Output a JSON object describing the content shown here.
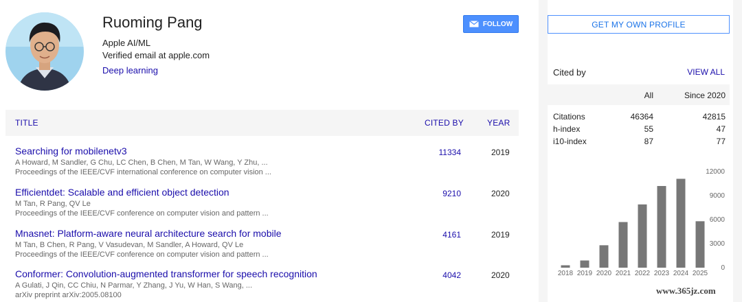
{
  "profile": {
    "name": "Ruoming Pang",
    "affiliation": "Apple AI/ML",
    "email": "Verified email at apple.com",
    "interest": "Deep learning",
    "follow_label": "FOLLOW"
  },
  "table": {
    "headers": {
      "title": "TITLE",
      "cited_by": "CITED BY",
      "year": "YEAR"
    },
    "articles": [
      {
        "title": "Searching for mobilenetv3",
        "authors": "A Howard, M Sandler, G Chu, LC Chen, B Chen, M Tan, W Wang, Y Zhu, ...",
        "venue": "Proceedings of the IEEE/CVF international conference on computer vision ...",
        "cited_by": "11334",
        "year": "2019"
      },
      {
        "title": "Efficientdet: Scalable and efficient object detection",
        "authors": "M Tan, R Pang, QV Le",
        "venue": "Proceedings of the IEEE/CVF conference on computer vision and pattern ...",
        "cited_by": "9210",
        "year": "2020"
      },
      {
        "title": "Mnasnet: Platform-aware neural architecture search for mobile",
        "authors": "M Tan, B Chen, R Pang, V Vasudevan, M Sandler, A Howard, QV Le",
        "venue": "Proceedings of the IEEE/CVF conference on computer vision and pattern ...",
        "cited_by": "4161",
        "year": "2019"
      },
      {
        "title": "Conformer: Convolution-augmented transformer for speech recognition",
        "authors": "A Gulati, J Qin, CC Chiu, N Parmar, Y Zhang, J Yu, W Han, S Wang, ...",
        "venue": "arXiv preprint arXiv:2005.08100",
        "cited_by": "4042",
        "year": "2020"
      }
    ]
  },
  "sidebar": {
    "own_profile_label": "GET MY OWN PROFILE",
    "cited_by_label": "Cited by",
    "view_all_label": "VIEW ALL",
    "stats_headers": {
      "all": "All",
      "since": "Since 2020"
    },
    "stats": [
      {
        "label": "Citations",
        "all": "46364",
        "since": "42815"
      },
      {
        "label": "h-index",
        "all": "55",
        "since": "47"
      },
      {
        "label": "i10-index",
        "all": "87",
        "since": "77"
      }
    ]
  },
  "chart_data": {
    "type": "bar",
    "categories": [
      "2018",
      "2019",
      "2020",
      "2021",
      "2022",
      "2023",
      "2024",
      "2025"
    ],
    "values": [
      300,
      900,
      2800,
      5700,
      7900,
      10200,
      11100,
      5800
    ],
    "ylim": [
      0,
      12000
    ],
    "yticks": [
      "12000",
      "9000",
      "6000",
      "3000",
      "0"
    ],
    "bar_color": "#777777"
  },
  "watermark": "www.365jz.com",
  "colors": {
    "link": "#1a0dab",
    "button": "#4d90fe",
    "bar": "#777777"
  }
}
